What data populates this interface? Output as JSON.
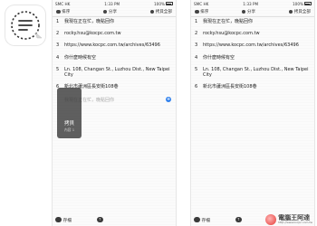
{
  "status": {
    "carrier": "SMC HK",
    "time": "1:33 PM",
    "battery": "100%"
  },
  "toolbar": {
    "sort_label": "排序",
    "share_label": "分享",
    "copy_all_label": "拷貝全部"
  },
  "items": [
    {
      "num": "1",
      "text": "我現在正在忙，晚點回你"
    },
    {
      "num": "2",
      "text": "rocky.hsu@kocpc.com.tw"
    },
    {
      "num": "3",
      "text": "https://www.kocpc.com.tw/archives/63496"
    },
    {
      "num": "4",
      "text": "你什麼時候有空"
    },
    {
      "num": "5",
      "text": "Ln. 108, Changan St., Luzhou Dist., New Taipei City"
    },
    {
      "num": "6",
      "text": "新北市蘆洲區長安街108巷"
    }
  ],
  "left_items": [
    {
      "num": "1",
      "text": "我現在正在忙，晚點回你"
    },
    {
      "num": "2",
      "text": "rocky.hsu@kocpc.com.tw"
    },
    {
      "num": "3",
      "text": "https://www.kocpc.com.tw/archives/63496"
    },
    {
      "num": "4",
      "text": "你什麼時候有空"
    },
    {
      "num": "5",
      "text": "Ln. 108, Changan St., Luzhou Dist., New Taipei City"
    },
    {
      "num": "6",
      "text": "新北市蘆洲區長安街108巷"
    }
  ],
  "placeholder": "我現在正在忙，晚點回你",
  "add_symbol": "+",
  "bottom": {
    "save_label": "存檔",
    "share_symbol": "↑"
  },
  "popup": {
    "title": "拷貝",
    "subtitle": "內容 1"
  },
  "watermark": {
    "main": "電腦王阿達",
    "url": "http://www.kocpc.com.tw"
  },
  "icons": {
    "app": "notepad-app-icon",
    "sort": "sort-icon",
    "share": "share-icon",
    "copy_all": "copy-all-icon",
    "save": "save-icon",
    "add": "add-icon"
  },
  "colors": {
    "accent": "#2f80ed",
    "text": "#222222",
    "placeholder": "#a9a9a9",
    "popup_bg": "#3c3c3c"
  }
}
